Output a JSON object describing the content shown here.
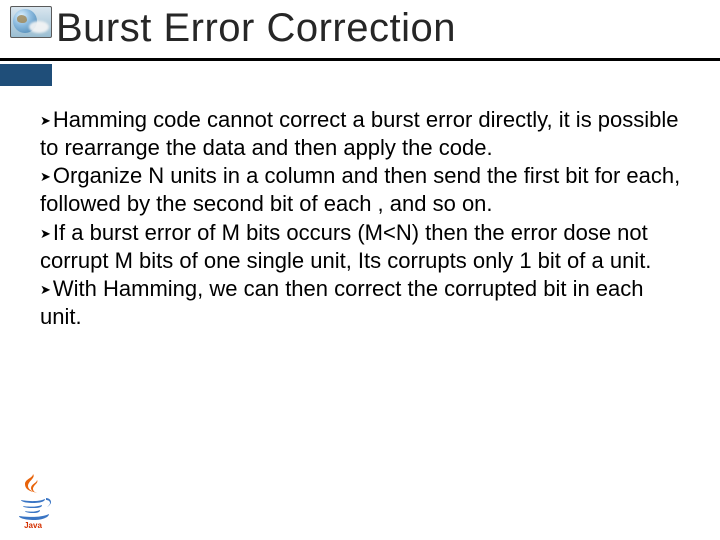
{
  "slide": {
    "title": "Burst Error Correction",
    "bullets": [
      "Hamming code cannot correct a burst error  directly, it is possible to  rearrange the data and  then apply the code.",
      "Organize N units in a column and then send the  first bit for each, followed by the second bit of  each , and so on.",
      "If a burst error of M bits occurs (M<N) then the error dose not corrupt M bits of one single unit, Its corrupts only 1 bit of a unit.",
      "With Hamming, we can then correct the corrupted bit in each unit."
    ]
  },
  "icons": {
    "corner": "globe-icon",
    "footer": "java-icon"
  },
  "colors": {
    "accent": "#1f4e79",
    "rule": "#000000"
  }
}
